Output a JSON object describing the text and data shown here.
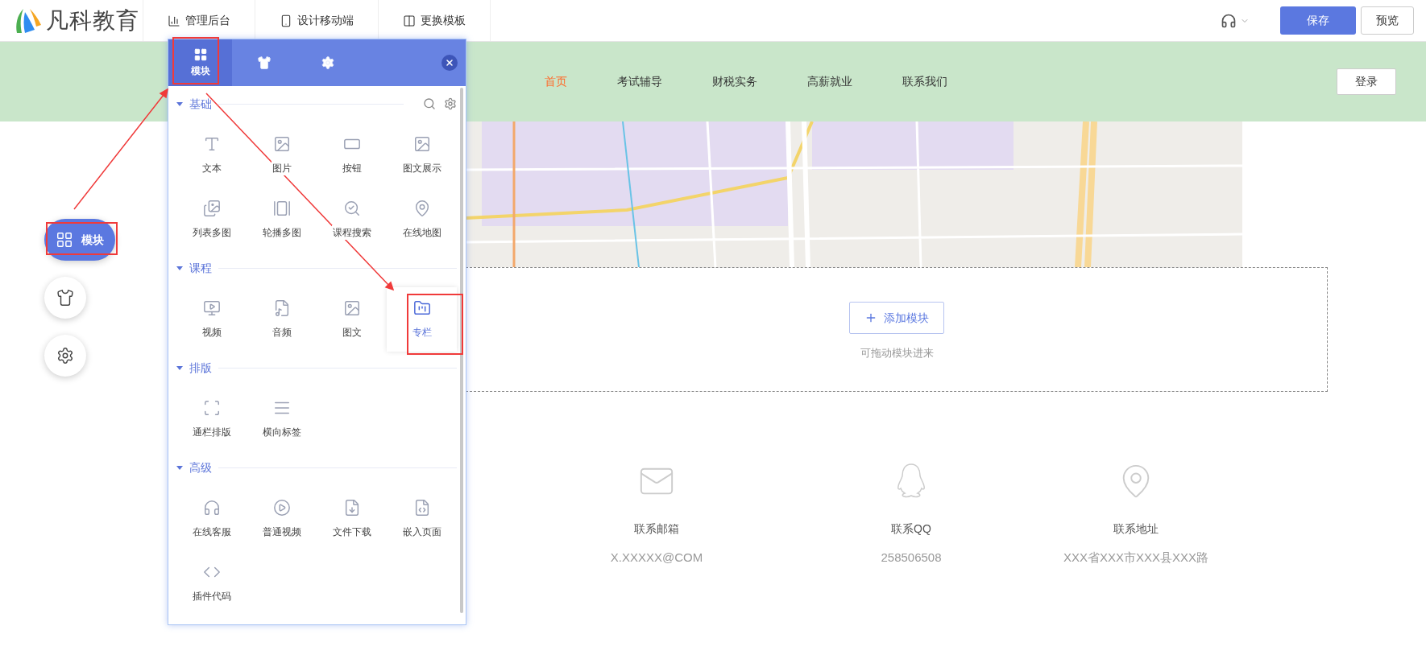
{
  "topbar": {
    "logo_text": "凡科教育",
    "nav": [
      {
        "kind": "admin",
        "label": "管理后台"
      },
      {
        "kind": "mobile",
        "label": "设计移动端"
      },
      {
        "kind": "template",
        "label": "更换模板"
      }
    ],
    "save": "保存",
    "preview": "预览"
  },
  "site_header": {
    "nav": [
      {
        "label": "首页",
        "selected": true
      },
      {
        "label": "考试辅导",
        "selected": false
      },
      {
        "label": "财税实务",
        "selected": false
      },
      {
        "label": "高薪就业",
        "selected": false
      },
      {
        "label": "联系我们",
        "selected": false
      }
    ],
    "login": "登录"
  },
  "add_module": {
    "button": "添加模块",
    "hint": "可拖动模块进来"
  },
  "contacts": [
    {
      "kind": "email",
      "label": "联系邮箱",
      "value": "X.XXXXX@COM"
    },
    {
      "kind": "qq",
      "label": "联系QQ",
      "value": "258506508"
    },
    {
      "kind": "address",
      "label": "联系地址",
      "value": "XXX省XXX市XXX县XXX路"
    }
  ],
  "side_buttons": [
    {
      "kind": "modules",
      "label": "模块",
      "selected": true
    },
    {
      "kind": "theme",
      "selected": false
    },
    {
      "kind": "settings",
      "selected": false
    }
  ],
  "panel": {
    "tabs": [
      {
        "kind": "modules",
        "label": "模块",
        "selected": true
      },
      {
        "kind": "theme",
        "selected": false
      },
      {
        "kind": "settings",
        "selected": false
      }
    ],
    "sections": [
      {
        "title": "基础",
        "expanded": true,
        "tools": true,
        "items": [
          {
            "kind": "text",
            "label": "文本",
            "selected": false
          },
          {
            "kind": "image",
            "label": "图片",
            "selected": false
          },
          {
            "kind": "button",
            "label": "按钮",
            "selected": false
          },
          {
            "kind": "showcase",
            "label": "图文展示",
            "selected": false
          },
          {
            "kind": "gallery",
            "label": "列表多图",
            "selected": false
          },
          {
            "kind": "carousel",
            "label": "轮播多图",
            "selected": false
          },
          {
            "kind": "search",
            "label": "课程搜索",
            "selected": false
          },
          {
            "kind": "map",
            "label": "在线地图",
            "selected": false
          }
        ]
      },
      {
        "title": "课程",
        "expanded": true,
        "tools": false,
        "items": [
          {
            "kind": "video",
            "label": "视频",
            "selected": false
          },
          {
            "kind": "audio",
            "label": "音频",
            "selected": false
          },
          {
            "kind": "article",
            "label": "图文",
            "selected": false
          },
          {
            "kind": "column",
            "label": "专栏",
            "selected": true
          }
        ]
      },
      {
        "title": "排版",
        "expanded": true,
        "tools": false,
        "items": [
          {
            "kind": "fullwidth",
            "label": "通栏排版",
            "selected": false
          },
          {
            "kind": "tabs",
            "label": "横向标签",
            "selected": false
          }
        ]
      },
      {
        "title": "高级",
        "expanded": true,
        "tools": false,
        "items": [
          {
            "kind": "service",
            "label": "在线客服",
            "selected": false
          },
          {
            "kind": "player",
            "label": "普通视频",
            "selected": false
          },
          {
            "kind": "download",
            "label": "文件下载",
            "selected": false
          },
          {
            "kind": "embed",
            "label": "嵌入页面",
            "selected": false
          },
          {
            "kind": "code",
            "label": "插件代码",
            "selected": false
          }
        ]
      }
    ]
  }
}
